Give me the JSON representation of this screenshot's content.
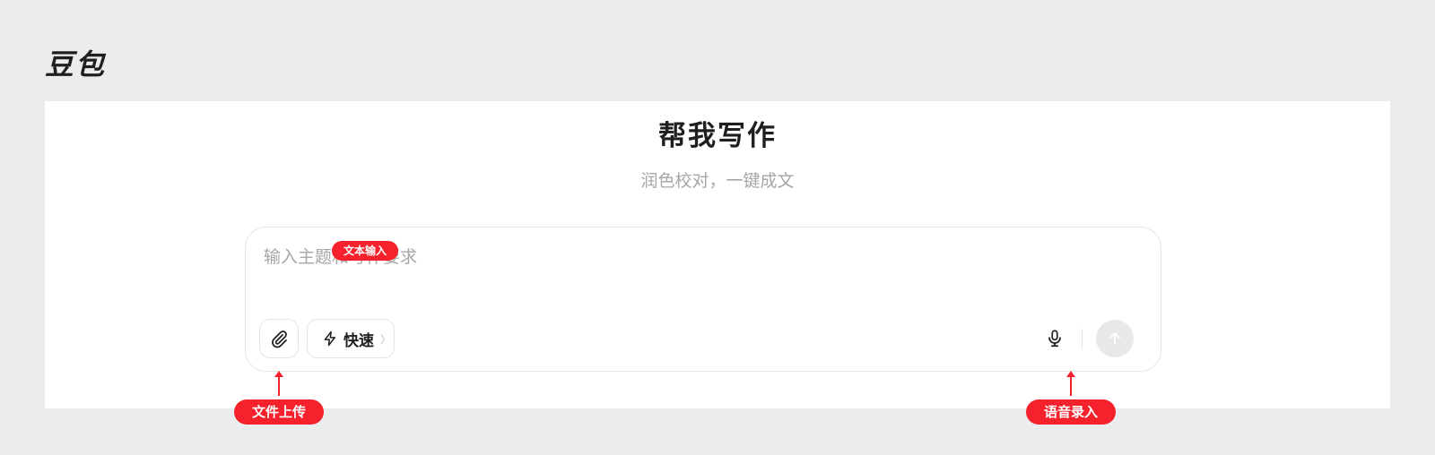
{
  "brand": {
    "name": "豆包"
  },
  "hero": {
    "title": "帮我写作",
    "subtitle": "润色校对，一键成文"
  },
  "composer": {
    "placeholder": "输入主题和写作要求",
    "attach_icon": "paperclip-icon",
    "quick": {
      "label": "快速",
      "icon": "lightning-icon",
      "chevron": "〉"
    },
    "mic_icon": "microphone-icon",
    "send_icon": "arrow-up-icon"
  },
  "annotations": {
    "text_input": "文本输入",
    "file_upload": "文件上传",
    "voice_input": "语音录入",
    "color": "#f5222d"
  }
}
